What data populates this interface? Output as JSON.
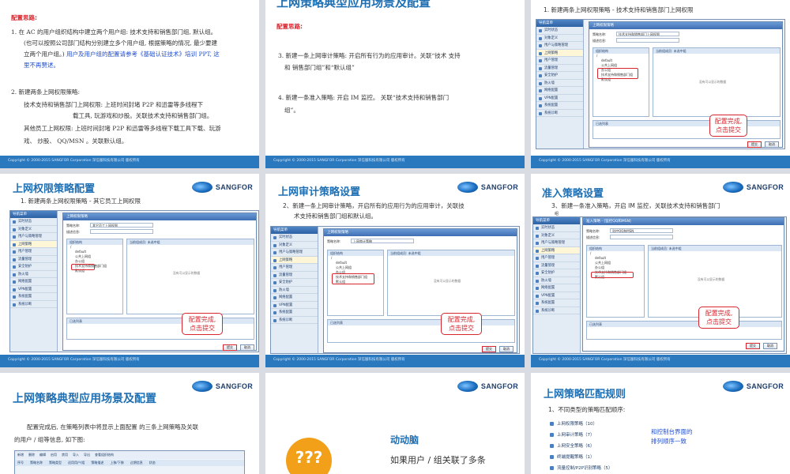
{
  "footer_text": "Copyright © 2000-2015 SANGFOR Corporation  深信服科技有限公司  版权所有",
  "logo_text": "SANGFOR",
  "console": {
    "nav_header": "导航菜单",
    "nav_items": [
      "实时状态",
      "对象定义",
      "用户与策略管理",
      "上网策略",
      "用户管理",
      "流量管理",
      "安全防护",
      "防火墙",
      "网络配置",
      "VPN配置",
      "系统配置",
      "系统诊断"
    ],
    "win_title": "上网权限策略",
    "enable_label": "启用该策略",
    "name_label": "策略名称:",
    "desc_label": "描述信息:",
    "tabs": [
      "策略设置",
      "适用用户",
      "适用位置"
    ],
    "tree_head": "组织结构",
    "tree_items": [
      "/",
      "default",
      "公共上网组",
      "办公组",
      "技术支持和销售部门组",
      "默认组"
    ],
    "list_head": "当前组成员: 未选中组",
    "col_name": "名称",
    "col_type": "类型",
    "nodata": "没有可以显示的数据",
    "selected_head": "已选列表",
    "ok": "提交",
    "cancel": "取消",
    "pager": "第 1 共 1 页"
  },
  "slide1": {
    "heading": "配置思路:",
    "p1": "1.  在 AC 的用户组织结构中建立两个用户组: 技术支持和销售部门组, 默认组。",
    "p1b": "(也可以按照公司部门结构分别建立多个用户组, 根据策略的情况, 最少要建",
    "p1c": "立两个用户组。) ",
    "p1link": "用户及用户组的配置请参考《基础认证技术》培训 PPT, 这",
    "p1link2": "里不再赘述。",
    "p2": "2.  新建两条上网权限策略:",
    "p2a": "技术支持和销售部门上网权限: 上班时间封堵 P2P 和迅雷等多线程下",
    "p2b": "载工具, 玩游戏和炒股。关联技术支持和销售部门组。",
    "p2c": "其他员工上网权限: 上班时间封堵 P2P 和迅雷等多线程下载工具下载、玩游",
    "p2d": "戏、 炒股、 QQ/MSN 。关联默认组。"
  },
  "slide2": {
    "title": "上网策略典型应用场景及配置",
    "heading": "配置思路:",
    "p3": "3.    新建一条上网审计策略: 开启所有行为的应用审计。关联“技术 支持",
    "p3b": "和 销售部门组”和“默认组”",
    "p4": "4.    新建一条准入策略: 开启 IM 监控。 关联“技术支持和销售部门",
    "p4b": "组”。"
  },
  "slide3": {
    "title": "上网策略典型应用场景及配置",
    "sub": "1.  新建两条上网权限策略 - 技术支持和销售部门上网权限",
    "policy_name": "技术支持和销售部门上网权限",
    "callout": [
      "配置完成,",
      "点击提交"
    ]
  },
  "slide4": {
    "title": "上网权限策略配置",
    "sub": "1.  新建两条上网权限策略 - 其它员工上网权限",
    "policy_name": "其它员工上网权限",
    "callout": [
      "配置完成,",
      "点击提交"
    ]
  },
  "slide5": {
    "title": "上网审计策略设置",
    "sub": "2、新建一条上网审计策略，开启所有的应用行为的应用审计，关联技",
    "sub2": "术支持和销售部门组和默认组。",
    "policy_name": "上网审计策略",
    "callout": [
      "配置完成,",
      "点击提交"
    ]
  },
  "slide6": {
    "title": "准入策略设置",
    "sub": "3、新建一条准入策略，开启 IM 监控，关联技术支持和销售部门",
    "sub2": "组",
    "win_title": "准入策略 - [监控QQ和MSN]",
    "policy_name": "监控QQ和MSN",
    "callout": [
      "配置完成,",
      "点击提交"
    ]
  },
  "slide7": {
    "title": "上网策略典型应用场景及配置",
    "p1": "配置完成后, 在策略列表中将显示上面配置 的三条上网策略及关联",
    "p2": "的用户 / 组等信息, 如下图:",
    "toolbar": [
      "新增",
      "删除",
      "编辑",
      "启用",
      "禁用",
      "导入",
      "导出",
      "查看组织结构"
    ],
    "cols": [
      "序号",
      "策略名称",
      "策略类型",
      "适用用户/组",
      "策略描述",
      "上移/下移",
      "过期信息",
      "状态"
    ]
  },
  "slide8": {
    "heading": "动动脑",
    "text": "如果用户 / 组关联了多条",
    "icon_text": "???"
  },
  "slide9": {
    "title": "上网策略匹配规则",
    "sub": "1、不同类型的策略匹配顺序:",
    "rules": [
      "上网权限策略（10）",
      "上网审计策略（7）",
      "上网安全策略（6）",
      "终端提醒策略（1）",
      "流量控制/P2P识别策略（5）"
    ],
    "note1": "和控制台界面的",
    "note2": "排列顺序一致"
  }
}
